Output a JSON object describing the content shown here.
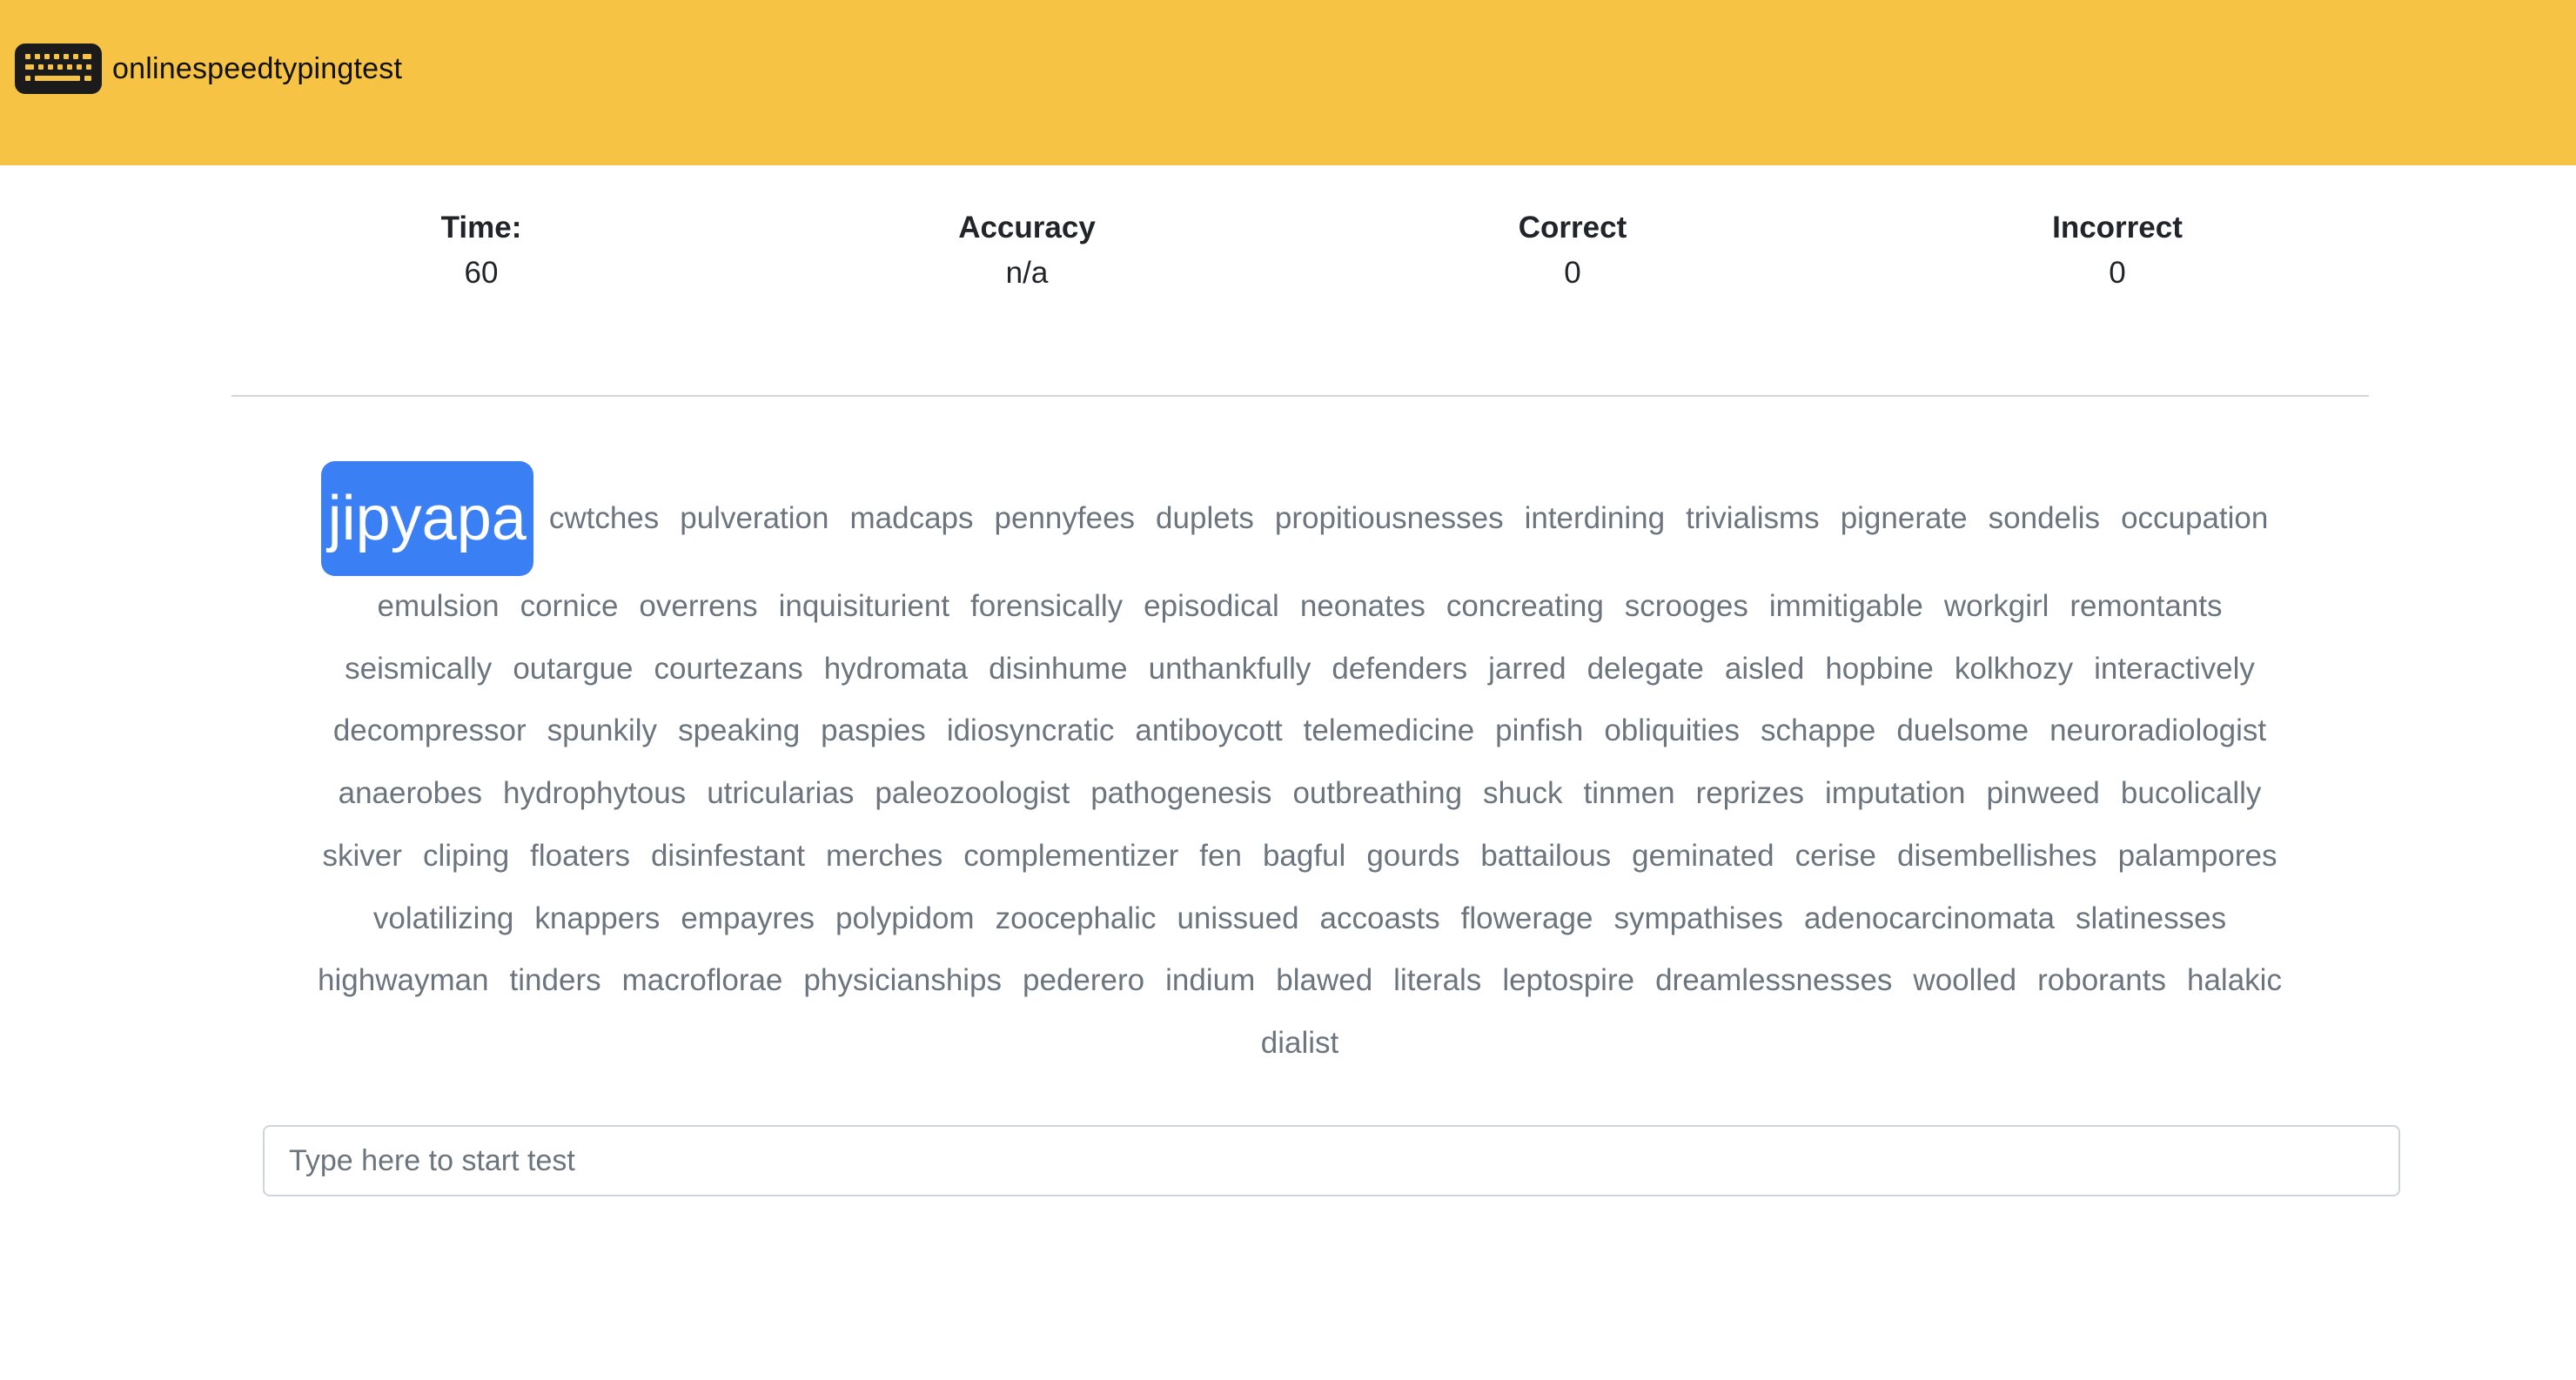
{
  "brand": {
    "name": "onlinespeedtypingtest",
    "icon": "keyboard-icon",
    "color": "#f6c344"
  },
  "stats": [
    {
      "label": "Time:",
      "value": "60"
    },
    {
      "label": "Accuracy",
      "value": "n/a"
    },
    {
      "label": "Correct",
      "value": "0"
    },
    {
      "label": "Incorrect",
      "value": "0"
    }
  ],
  "current_word": "jipyapa",
  "accent_color": "#3b7ff5",
  "word_lines": [
    [
      "cwtches",
      "pulveration",
      "madcaps",
      "pennyfees",
      "duplets",
      "propitiousnesses",
      "interdining",
      "trivialisms",
      "pignerate",
      "sondelis",
      "occupation"
    ],
    [
      "emulsion",
      "cornice",
      "overrens",
      "inquisiturient",
      "forensically",
      "episodical",
      "neonates",
      "concreating",
      "scrooges",
      "immitigable",
      "workgirl",
      "remontants"
    ],
    [
      "seismically",
      "outargue",
      "courtezans",
      "hydromata",
      "disinhume",
      "unthankfully",
      "defenders",
      "jarred",
      "delegate",
      "aisled",
      "hopbine",
      "kolkhozy",
      "interactively"
    ],
    [
      "decompressor",
      "spunkily",
      "speaking",
      "paspies",
      "idiosyncratic",
      "antiboycott",
      "telemedicine",
      "pinfish",
      "obliquities",
      "schappe",
      "duelsome",
      "neuroradiologist"
    ],
    [
      "anaerobes",
      "hydrophytous",
      "utricularias",
      "paleozoologist",
      "pathogenesis",
      "outbreathing",
      "shuck",
      "tinmen",
      "reprizes",
      "imputation",
      "pinweed",
      "bucolically"
    ],
    [
      "skiver",
      "cliping",
      "floaters",
      "disinfestant",
      "merches",
      "complementizer",
      "fen",
      "bagful",
      "gourds",
      "battailous",
      "geminated",
      "cerise",
      "disembellishes",
      "palampores"
    ],
    [
      "volatilizing",
      "knappers",
      "empayres",
      "polypidom",
      "zoocephalic",
      "unissued",
      "accoasts",
      "flowerage",
      "sympathises",
      "adenocarcinomata",
      "slatinesses"
    ],
    [
      "highwayman",
      "tinders",
      "macroflorae",
      "physicianships",
      "pederero",
      "indium",
      "blawed",
      "literals",
      "leptospire",
      "dreamlessnesses",
      "woolled",
      "roborants",
      "halakic"
    ],
    [
      "dialist"
    ]
  ],
  "input": {
    "placeholder": "Type here to start test",
    "value": ""
  }
}
